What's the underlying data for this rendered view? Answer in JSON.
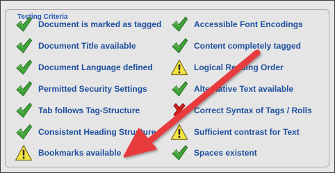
{
  "panel": {
    "legend": "Testing Criteria"
  },
  "colors": {
    "label_text": "#1e4f9e",
    "legend_text": "#1f56b3",
    "check_green": "#3fa33a",
    "warning_yellow": "#f6e444",
    "fail_red": "#d51f1f",
    "annotation_arrow": "#e83b3d"
  },
  "criteria_left": [
    {
      "label": "Document is marked as tagged",
      "status": "pass",
      "icon": "check-icon"
    },
    {
      "label": "Document Title available",
      "status": "pass",
      "icon": "check-icon"
    },
    {
      "label": "Document Language defined",
      "status": "pass",
      "icon": "check-icon"
    },
    {
      "label": "Permitted Security Settings",
      "status": "pass",
      "icon": "check-icon"
    },
    {
      "label": "Tab follows Tag-Structure",
      "status": "pass",
      "icon": "check-icon"
    },
    {
      "label": "Consistent Heading Structure",
      "status": "pass",
      "icon": "check-icon"
    },
    {
      "label": "Bookmarks available",
      "status": "warning",
      "icon": "warning-icon"
    }
  ],
  "criteria_right": [
    {
      "label": "Accessible Font Encodings",
      "status": "pass",
      "icon": "check-icon"
    },
    {
      "label": "Content completely tagged",
      "status": "pass",
      "icon": "check-icon"
    },
    {
      "label": "Logical Reading Order",
      "status": "warning",
      "icon": "warning-icon"
    },
    {
      "label": "Alternative Text available",
      "status": "pass",
      "icon": "check-icon"
    },
    {
      "label": "Correct Syntax of Tags / Rolls",
      "status": "fail",
      "icon": "cross-icon"
    },
    {
      "label": "Sufficient contrast for Text",
      "status": "warning",
      "icon": "warning-icon"
    },
    {
      "label": "Spaces existent",
      "status": "pass",
      "icon": "check-icon"
    }
  ]
}
